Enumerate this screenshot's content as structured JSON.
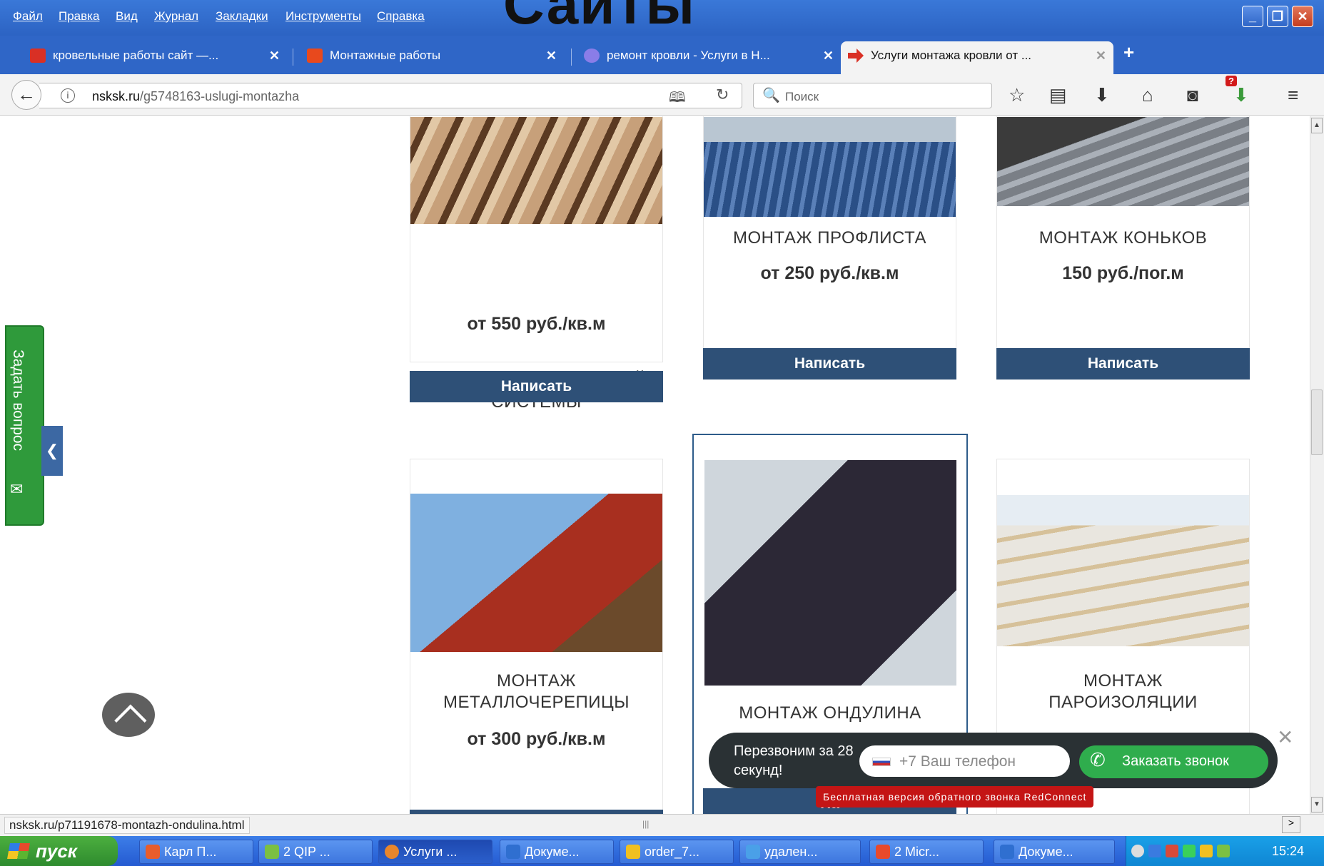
{
  "overlay_title": "Сайты",
  "menubar": {
    "items": [
      "Файл",
      "Правка",
      "Вид",
      "Журнал",
      "Закладки",
      "Инструменты",
      "Справка"
    ]
  },
  "tabs": [
    {
      "label": "кровельные работы сайт —...",
      "favicon_color": "#d93025",
      "active": false
    },
    {
      "label": "Монтажные работы",
      "favicon_color": "#e8491d",
      "active": false
    },
    {
      "label": "ремонт кровли - Услуги в Н...",
      "favicon_color": "#8a7de8",
      "active": false
    },
    {
      "label": "Услуги монтажа кровли от ...",
      "favicon_color": "#d93025",
      "active": true
    }
  ],
  "navbar": {
    "url_domain": "nsksk.ru",
    "url_path": "/g5748163-uslugi-montazha",
    "search_placeholder": "Поиск"
  },
  "cards": [
    {
      "title": "МОНТАЖ СТРОПИЛЬНОЙ СИСТЕМЫ",
      "price": "от 550 руб./кв.м",
      "button": "Написать"
    },
    {
      "title": "МОНТАЖ ПРОФЛИСТА",
      "price": "от 250 руб./кв.м",
      "button": "Написать"
    },
    {
      "title": "МОНТАЖ КОНЬКОВ",
      "price": "150 руб./пог.м",
      "button": "Написать"
    },
    {
      "title": "МОНТАЖ МЕТАЛЛОЧЕРЕПИЦЫ",
      "price": "от 300 руб./кв.м",
      "button": "Написать"
    },
    {
      "title": "МОНТАЖ ОНДУЛИНА",
      "price": "",
      "button": "На"
    },
    {
      "title": "МОНТАЖ ПАРОИЗОЛЯЦИИ",
      "price": "",
      "button": ""
    }
  ],
  "ask_question": "Задать вопрос",
  "callback_widget": {
    "text": "Перезвоним за 28 секунд!",
    "phone_placeholder": "+7 Ваш телефон",
    "button": "Заказать звонок",
    "free_notice": "Бесплатная версия обратного звонка RedConnect"
  },
  "status_url": "nsksk.ru/p71191678-montazh-ondulina.html",
  "taskbar": {
    "start": "пуск",
    "items": [
      {
        "label": "Карл П...",
        "icon_color": "#e85d2c"
      },
      {
        "label": "2 QIP ...",
        "icon_color": "#7bc043"
      },
      {
        "label": "Услуги ...",
        "icon_color": "#e8862c"
      },
      {
        "label": "Докуме...",
        "icon_color": "#2f6fd0"
      },
      {
        "label": "order_7...",
        "icon_color": "#f0c020"
      },
      {
        "label": "удален...",
        "icon_color": "#4aa0e8"
      },
      {
        "label": "2 Micr...",
        "icon_color": "#e84a2c"
      },
      {
        "label": "Докуме...",
        "icon_color": "#2f6fd0"
      }
    ],
    "time": "15:24"
  }
}
